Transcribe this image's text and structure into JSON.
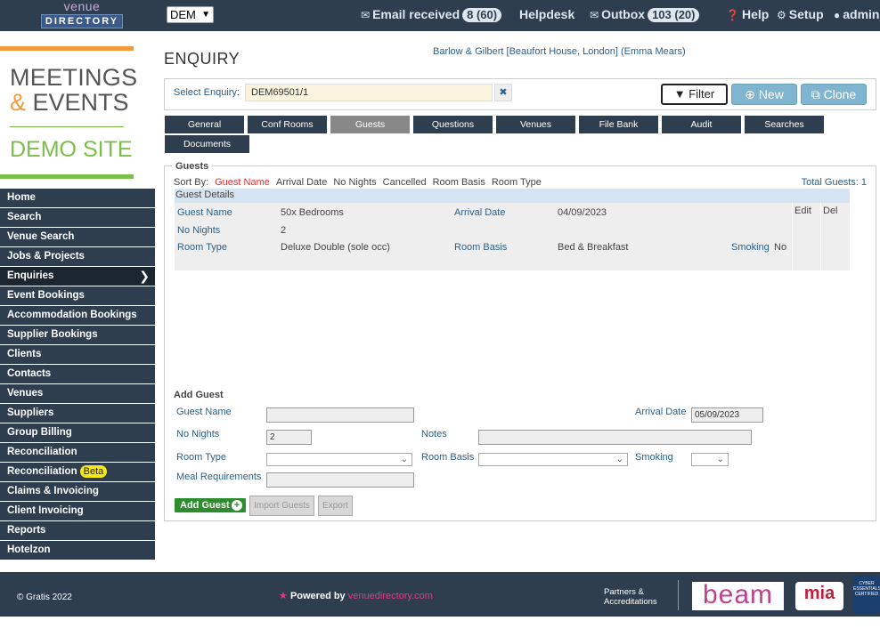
{
  "topbar": {
    "logo_line1": "venue",
    "logo_line2": "DIRECTORY",
    "site_select": "DEM",
    "email_received_label": "Email received",
    "email_received_count": "8 (60)",
    "helpdesk_label": "Helpdesk",
    "outbox_label": "Outbox",
    "outbox_count": "103 (20)",
    "help_label": "Help",
    "setup_label": "Setup",
    "admin_label": "admin"
  },
  "brand": {
    "line1": "MEETINGS",
    "amp": "&",
    "line2": "EVENTS",
    "line3": "DEMO SITE"
  },
  "sidebar": {
    "items": [
      {
        "label": "Home"
      },
      {
        "label": "Search"
      },
      {
        "label": "Venue Search"
      },
      {
        "label": "Jobs & Projects"
      },
      {
        "label": "Enquiries"
      },
      {
        "label": "Event Bookings"
      },
      {
        "label": "Accommodation Bookings"
      },
      {
        "label": "Supplier Bookings"
      },
      {
        "label": "Clients"
      },
      {
        "label": "Contacts"
      },
      {
        "label": "Venues"
      },
      {
        "label": "Suppliers"
      },
      {
        "label": "Group Billing"
      },
      {
        "label": "Reconciliation"
      },
      {
        "label": "Reconciliation"
      },
      {
        "label": "Claims & Invoicing"
      },
      {
        "label": "Client Invoicing"
      },
      {
        "label": "Reports"
      },
      {
        "label": "Hotelzon"
      }
    ],
    "beta_label": "Beta"
  },
  "main": {
    "title": "ENQUIRY",
    "client_link": "Barlow & Gilbert [Beaufort House, London] (Emma Mears)",
    "select_enquiry_label": "Select Enquiry:",
    "select_enquiry_value": "DEM69501/1",
    "filter_label": "Filter",
    "new_label": "New",
    "clone_label": "Clone",
    "tabs": [
      {
        "label": "General"
      },
      {
        "label": "Conf Rooms"
      },
      {
        "label": "Guests"
      },
      {
        "label": "Questions"
      },
      {
        "label": "Venues"
      },
      {
        "label": "File Bank"
      },
      {
        "label": "Audit"
      },
      {
        "label": "Searches"
      },
      {
        "label": "Documents"
      }
    ]
  },
  "guests": {
    "legend": "Guests",
    "sort_by_label": "Sort By:",
    "sort_options": [
      "Guest Name",
      "Arrival Date",
      "No Nights",
      "Cancelled",
      "Room Basis",
      "Room Type"
    ],
    "total_guests": "Total Guests: 1",
    "details_header": "Guest Details",
    "row": {
      "guest_name_label": "Guest Name",
      "guest_name": "50x Bedrooms",
      "arrival_date_label": "Arrival Date",
      "arrival_date": "04/09/2023",
      "no_nights_label": "No Nights",
      "no_nights": "2",
      "room_type_label": "Room Type",
      "room_type": "Deluxe Double (sole occ)",
      "room_basis_label": "Room Basis",
      "room_basis": "Bed & Breakfast",
      "smoking_label": "Smoking",
      "smoking": "No",
      "edit_label": "Edit",
      "del_label": "Del"
    }
  },
  "add_guest": {
    "title": "Add Guest",
    "guest_name_label": "Guest Name",
    "guest_name_value": "",
    "arrival_date_label": "Arrival Date",
    "arrival_date_value": "05/09/2023",
    "no_nights_label": "No Nights",
    "no_nights_value": "2",
    "notes_label": "Notes",
    "notes_value": "",
    "room_type_label": "Room Type",
    "room_basis_label": "Room Basis",
    "smoking_label": "Smoking",
    "meal_requirements_label": "Meal Requirements",
    "meal_requirements_value": "",
    "add_guest_button": "Add Guest",
    "import_guests_button": "Import Guests",
    "export_button": "Export"
  },
  "footer": {
    "copyright": "© Gratis 2022",
    "powered_by": "Powered by",
    "powered_site": "venuedirectory.com",
    "partners_line1": "Partners &",
    "partners_line2": "Accreditations",
    "beam_logo": "beam",
    "mia_logo": "mia",
    "cyber_logo": "CYBER ESSENTIALS CERTIFIED"
  },
  "colors": {
    "nav_dark": "#2e3e4e",
    "accent_orange": "#f39a3d",
    "accent_green": "#7bbf4a",
    "link_blue": "#2a5f8a",
    "sort_active": "#dd3333",
    "beta_yellow": "#f7e81a"
  }
}
